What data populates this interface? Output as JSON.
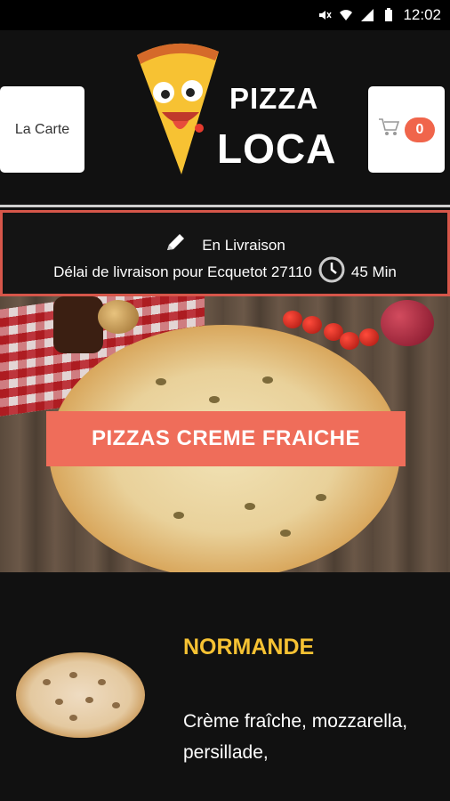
{
  "status_bar": {
    "time": "12:02"
  },
  "header": {
    "menu_button_label": "La Carte",
    "cart_count": "0",
    "logo_word_1": "PIZZA",
    "logo_word_2": "LOCA"
  },
  "delivery": {
    "mode_label": "En Livraison",
    "delay_text": "Délai de livraison pour Ecquetot 27110",
    "delay_time": "45 Min"
  },
  "category": {
    "title": "PIZZAS CREME FRAICHE"
  },
  "product": {
    "name": "NORMANDE",
    "description": "Crème fraîche, mozzarella, persillade,"
  },
  "colors": {
    "accent": "#ef6d5a",
    "product_name": "#f6c233",
    "background": "#111111"
  }
}
